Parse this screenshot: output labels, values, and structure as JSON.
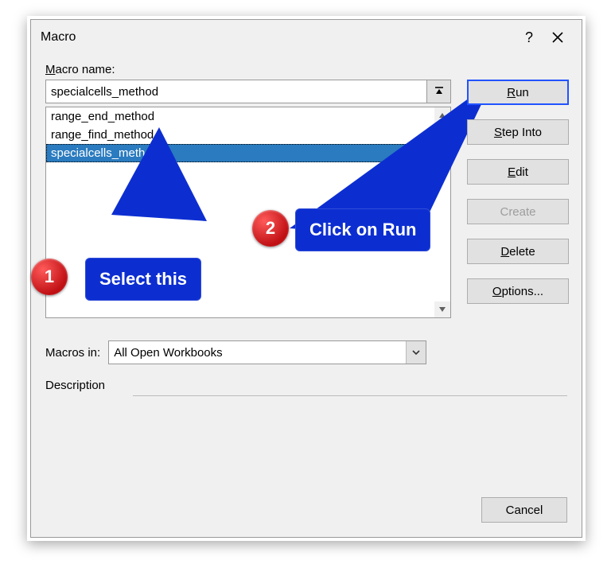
{
  "title": "Macro",
  "labels": {
    "macro_name_prefix": "M",
    "macro_name_rest": "acro name:",
    "macros_in_prefix": "M",
    "macros_in_rest": "acros in:",
    "description": "Description"
  },
  "macro_name_value": "specialcells_method",
  "macro_list": [
    {
      "name": "range_end_method",
      "selected": false
    },
    {
      "name": "range_find_method",
      "selected": false
    },
    {
      "name": "specialcells_method",
      "selected": true
    }
  ],
  "buttons": {
    "run_prefix": "R",
    "run_rest": "un",
    "step_prefix": "S",
    "step_rest": "tep Into",
    "edit_prefix": "E",
    "edit_rest": "dit",
    "create": "Create",
    "delete_prefix": "D",
    "delete_rest": "elete",
    "options_prefix": "O",
    "options_rest": "ptions...",
    "cancel": "Cancel"
  },
  "macros_in_value": "All Open Workbooks",
  "help_symbol": "?",
  "annotations": {
    "select_this": "Select this",
    "click_on_run": "Click on Run",
    "n1": "1",
    "n2": "2"
  }
}
